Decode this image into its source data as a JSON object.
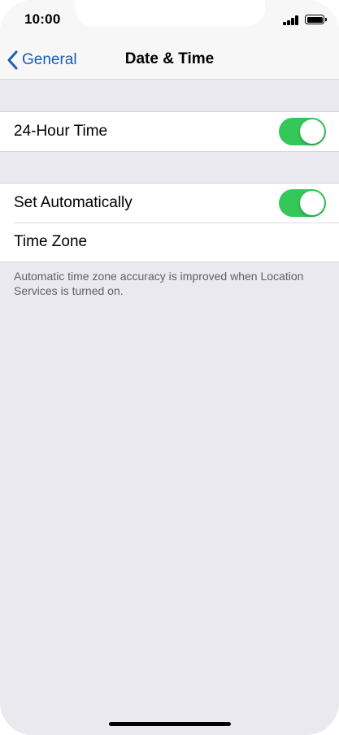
{
  "status_bar": {
    "time": "10:00"
  },
  "nav": {
    "back_label": "General",
    "title": "Date & Time"
  },
  "settings": {
    "group1": [
      {
        "label": "24-Hour Time",
        "toggle": true
      }
    ],
    "group2": [
      {
        "label": "Set Automatically",
        "toggle": true
      },
      {
        "label": "Time Zone"
      }
    ],
    "footnote": "Automatic time zone accuracy is improved when Location Services is turned on."
  },
  "colors": {
    "accent": "#1a5fb4",
    "toggle_on": "#34c759",
    "background": "#e9e9ef"
  },
  "icons": {
    "back": "chevron-left-icon",
    "signal": "cellular-signal-icon",
    "battery": "battery-icon"
  }
}
